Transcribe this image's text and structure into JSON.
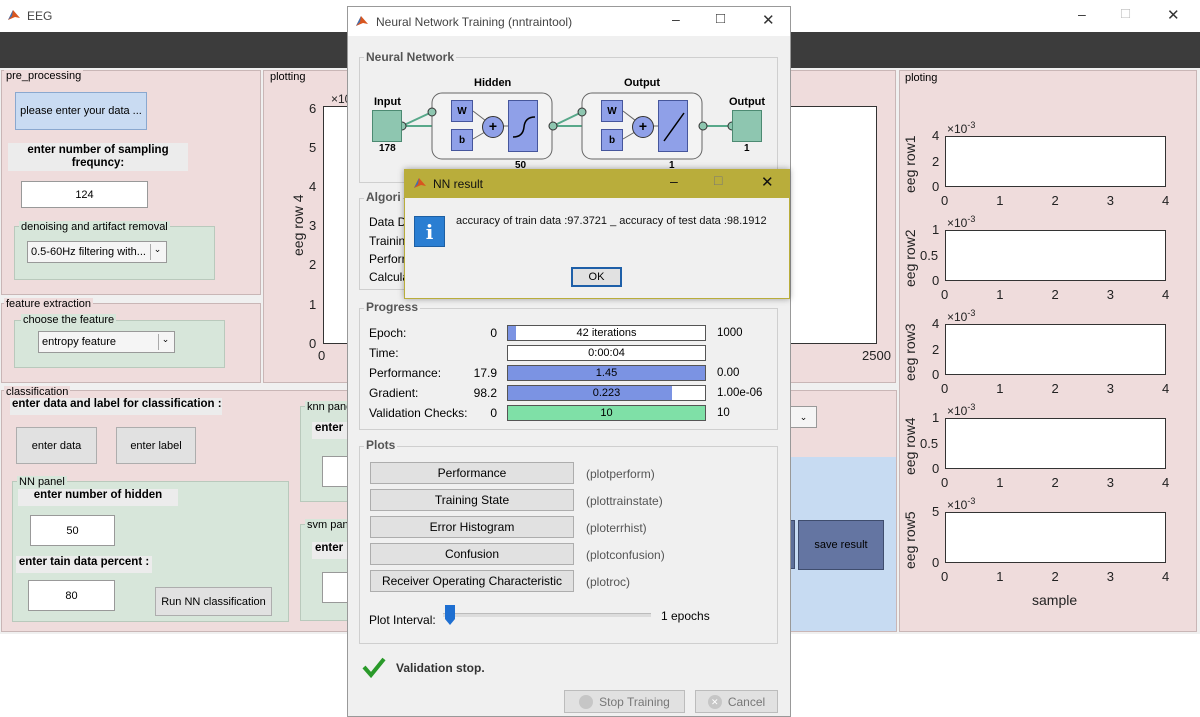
{
  "eeg_window": {
    "title": "EEG",
    "controls": {
      "minimize": "–",
      "maximize": "□",
      "close": "✕"
    }
  },
  "pre_processing": {
    "title": "pre_processing",
    "enter_data_button": "please enter your data ...",
    "sampling_label": "enter number of sampling frequncy:",
    "sampling_value": "124",
    "denoise_title": "denoising and artifact removal",
    "filter_value": "0.5-60Hz filtering with..."
  },
  "feature_extraction": {
    "title": "feature extraction",
    "choose_title": "choose the feature",
    "feature_value": "entropy feature"
  },
  "classification": {
    "title": "classification",
    "enter_label_text": "enter data and label for classification :",
    "enter_data_button": "enter data",
    "enter_label_button": "enter label",
    "nn_panel": {
      "title": "NN panel",
      "hidden_label": "enter number of hidden",
      "hidden_value": "50",
      "percent_label": "enter tain data percent :",
      "percent_value": "80",
      "run_button": "Run NN classification"
    },
    "knn_panel": {
      "title": "knn pane",
      "enter_text": "enter"
    },
    "svm_panel": {
      "title": "svm pan",
      "enter_text": "enter"
    },
    "save_button": "save result"
  },
  "plotting": {
    "title": "plotting",
    "ylabel": "eeg row 4",
    "exponent": "×10",
    "yticks": [
      "6",
      "5",
      "4",
      "3",
      "2",
      "1",
      "0"
    ],
    "xticks": [
      "0",
      "2500"
    ]
  },
  "ploting": {
    "title": "ploting",
    "xlabel": "sample",
    "exponent": "×10",
    "exp_power": "-3",
    "xticks": [
      "0",
      "1",
      "2",
      "3",
      "4"
    ],
    "rows": [
      {
        "ylabel": "eeg row1",
        "yticks": [
          "4",
          "2",
          "0"
        ]
      },
      {
        "ylabel": "eeg row2",
        "yticks": [
          "1",
          "0.5",
          "0"
        ]
      },
      {
        "ylabel": "eeg row3",
        "yticks": [
          "4",
          "2",
          "0"
        ]
      },
      {
        "ylabel": "eeg row4",
        "yticks": [
          "1",
          "0.5",
          "0"
        ]
      },
      {
        "ylabel": "eeg row5",
        "yticks": [
          "5",
          "0"
        ]
      }
    ]
  },
  "nntraintool": {
    "title": "Neural Network Training (nntraintool)",
    "network": {
      "section": "Neural Network",
      "input_label": "Input",
      "input_size": "178",
      "hidden_label": "Hidden",
      "hidden_size": "50",
      "output_layer_label": "Output",
      "output_layer_size": "1",
      "output_label": "Output",
      "output_size": "1",
      "w": "W",
      "b": "b",
      "plus": "+"
    },
    "algorithms": {
      "section": "Algori",
      "rows": [
        "Data D",
        "Trainin",
        "Perforr",
        "Calcula"
      ]
    },
    "progress": {
      "section": "Progress",
      "rows": [
        {
          "label": "Epoch:",
          "min": "0",
          "value": "42 iterations",
          "max": "1000",
          "fraction": 0.042
        },
        {
          "label": "Time:",
          "min": "",
          "value": "0:00:04",
          "max": "",
          "fraction": 0
        },
        {
          "label": "Performance:",
          "min": "17.9",
          "value": "1.45",
          "max": "0.00",
          "fraction": 1.0
        },
        {
          "label": "Gradient:",
          "min": "98.2",
          "value": "0.223",
          "max": "1.00e-06",
          "fraction": 0.83
        },
        {
          "label": "Validation Checks:",
          "min": "0",
          "value": "10",
          "max": "10",
          "fraction": 1.0
        }
      ]
    },
    "plots": {
      "section": "Plots",
      "buttons": [
        {
          "label": "Performance",
          "fn": "(plotperform)"
        },
        {
          "label": "Training State",
          "fn": "(plottrainstate)"
        },
        {
          "label": "Error Histogram",
          "fn": "(ploterrhist)"
        },
        {
          "label": "Confusion",
          "fn": "(plotconfusion)"
        },
        {
          "label": "Receiver Operating Characteristic",
          "fn": "(plotroc)"
        }
      ],
      "interval_label": "Plot Interval:",
      "interval_value": "1 epochs"
    },
    "status": "Validation stop.",
    "stop_button": "Stop Training",
    "cancel_button": "Cancel"
  },
  "dialog": {
    "title": "NN result",
    "message": "accuracy of train data :97.3721 _ accuracy of test data :98.1912",
    "ok": "OK"
  },
  "colors": {
    "pink_panel": "#efdcdc",
    "green_panel": "#d7e6da",
    "blue_fill": "#7b93e3",
    "green_fill": "#7fe0a7",
    "dialog_title": "#b9ad3b"
  }
}
